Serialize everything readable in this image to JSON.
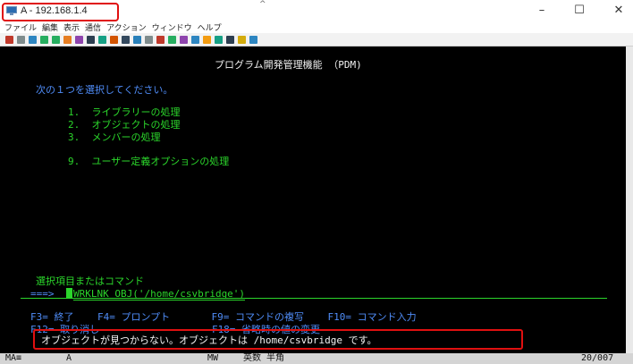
{
  "window": {
    "title": "A - 192.168.1.4",
    "icon": "terminal-monitor-icon",
    "minimize": "–",
    "maximize": "☐",
    "close": "✕",
    "caret": "^"
  },
  "menu": [
    "ファイル",
    "編集",
    "表示",
    "通信",
    "アクション",
    "ウィンドウ",
    "ヘルプ"
  ],
  "toolbar_colors": [
    "#c0392b",
    "#7f8c8d",
    "#2e86c1",
    "#27ae60",
    "#27ae60",
    "#e67e22",
    "#8e44ad",
    "#2c3e50",
    "#16a085",
    "#d35400",
    "#34495e",
    "#2980b9",
    "#7f8c8d",
    "#c0392b",
    "#27ae60",
    "#8e44ad",
    "#2e86c1",
    "#f39c12",
    "#16a085",
    "#2c3e50",
    "#d4ac0d",
    "#2e86c1"
  ],
  "screen": {
    "title": "プログラム開発管理機能 （PDM)",
    "prompt": "次の１つを選択してください。",
    "options": [
      "1.  ライブラリーの処理",
      "2.  オブジェクトの処理",
      "3.  メンバーの処理",
      "9.  ユーザー定義オプションの処理"
    ],
    "command_label": "選択項目またはコマンド",
    "command_arrow": "===>",
    "command_value": "WRKLNK OBJ('/home/csvbridge')",
    "fkeys_row1": "F3= 終了    F4= プロンプト       F9= コマンドの複写    F10= コマンド入力",
    "fkeys_row2": "F12= 取り消し                   F18= 省略時の値の変更",
    "message": "オブジェクトが見つからない。オブジェクトは /home/csvbridge です。"
  },
  "status": {
    "session": "MA",
    "mark": "≡",
    "id": "A",
    "mode": "MW",
    "input_mode": "英数 半角",
    "cursor_pos": "20/007"
  }
}
